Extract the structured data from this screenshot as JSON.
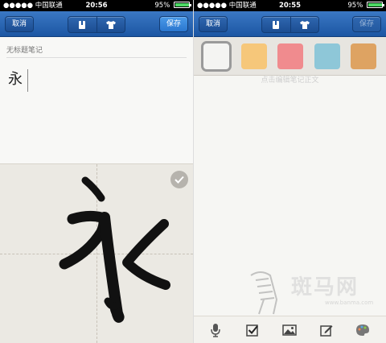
{
  "left": {
    "status": {
      "carrier": "●●●●● 中国联通",
      "time": "20:56",
      "battery": "95%",
      "battery_level": 0.95
    },
    "nav": {
      "cancel_label": "取消",
      "save_label": "保存"
    },
    "title_placeholder": "无标题笔记",
    "written_text": "永"
  },
  "right": {
    "status": {
      "carrier": "●●●●● 中国联通",
      "time": "20:55",
      "battery": "95%",
      "battery_level": 0.95
    },
    "nav": {
      "cancel_label": "取消",
      "save_label": "保存"
    },
    "palette": [
      {
        "name": "white",
        "color": "#f4f4f2",
        "selected": true
      },
      {
        "name": "yellow",
        "color": "#f6c77a",
        "selected": false
      },
      {
        "name": "pink",
        "color": "#f08b8e",
        "selected": false
      },
      {
        "name": "blue",
        "color": "#8ec7d8",
        "selected": false
      },
      {
        "name": "orange",
        "color": "#dea362",
        "selected": false
      }
    ],
    "body_placeholder": "点击编辑笔记正文",
    "toolbar": [
      "microphone-icon",
      "checkbox-icon",
      "image-icon",
      "edit-icon",
      "palette-icon"
    ]
  },
  "watermark": {
    "text": "斑马网",
    "url": "www.banma.com"
  },
  "colors": {
    "nav_blue": "#2a62ad",
    "save_active": "#3d88dd"
  }
}
